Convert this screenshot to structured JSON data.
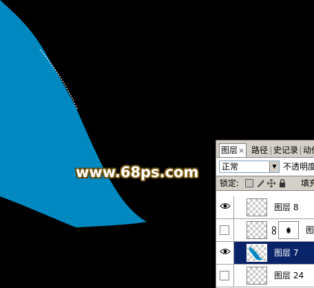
{
  "canvas": {
    "background_color": "#000000",
    "shape_color": "#0088c0",
    "watermark_text": "www.68ps.com"
  },
  "layers_panel": {
    "tabs": [
      {
        "label": "图层",
        "close": "×",
        "active": true
      },
      {
        "label": "路径",
        "active": false
      },
      {
        "label": "史记录",
        "active": false
      },
      {
        "label": "动作",
        "active": false
      }
    ],
    "blend_mode": "正常",
    "opacity_label": "不透明度",
    "lock_label": "锁定:",
    "fill_label": "填充",
    "layers": [
      {
        "name": "图层 8",
        "visible": true,
        "selected": false,
        "has_mask": false
      },
      {
        "name": "图",
        "visible": false,
        "selected": false,
        "has_mask": true
      },
      {
        "name": "图层 7",
        "visible": true,
        "selected": true,
        "has_mask": false
      },
      {
        "name": "图层 24",
        "visible": false,
        "selected": false,
        "has_mask": false
      }
    ],
    "selected_color": "#0a246a",
    "panel_color": "#d4d0c8"
  }
}
